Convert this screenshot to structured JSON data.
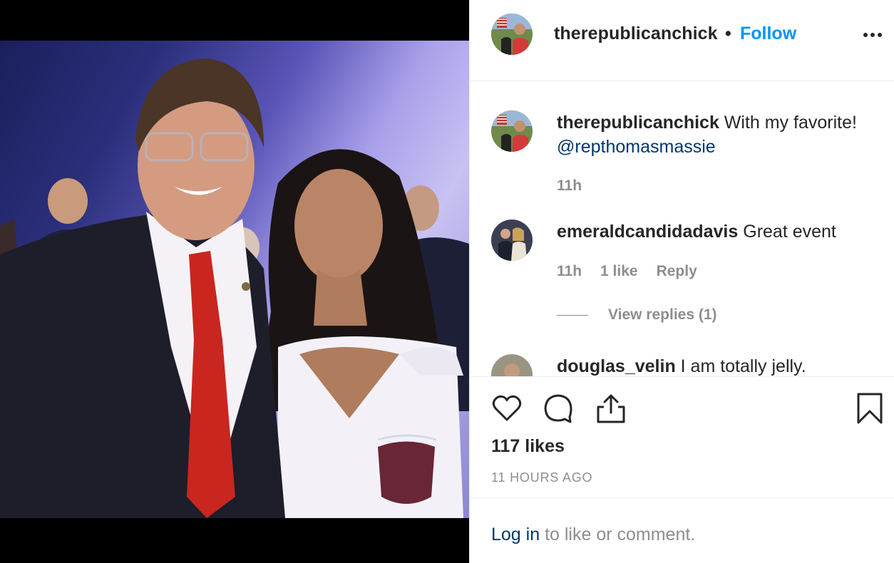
{
  "post": {
    "username": "therepublicanchick",
    "separator": "•",
    "follow_label": "Follow",
    "more_icon": "more-options-icon"
  },
  "comments": [
    {
      "username": "therepublicanchick",
      "text": " With my favorite!",
      "mention": "@repthomasmassie",
      "time": "11h"
    },
    {
      "username": "emeraldcandidadavis",
      "text": " Great event",
      "time": "11h",
      "likes": "1 like",
      "reply_label": "Reply",
      "view_replies": "View replies (1)"
    },
    {
      "username": "douglas_velin",
      "text": " I am totally jelly."
    }
  ],
  "actions": {
    "like_icon": "heart-icon",
    "comment_icon": "comment-icon",
    "share_icon": "share-icon",
    "save_icon": "bookmark-icon",
    "likes_count": "117 likes",
    "posted_ago": "11 HOURS AGO"
  },
  "footer": {
    "login_label": "Log in",
    "login_suffix": " to like or comment."
  },
  "colors": {
    "follow_blue": "#0095f6",
    "link_dark_blue": "#00376b",
    "muted_gray": "#8e8e8e",
    "text": "#262626"
  }
}
